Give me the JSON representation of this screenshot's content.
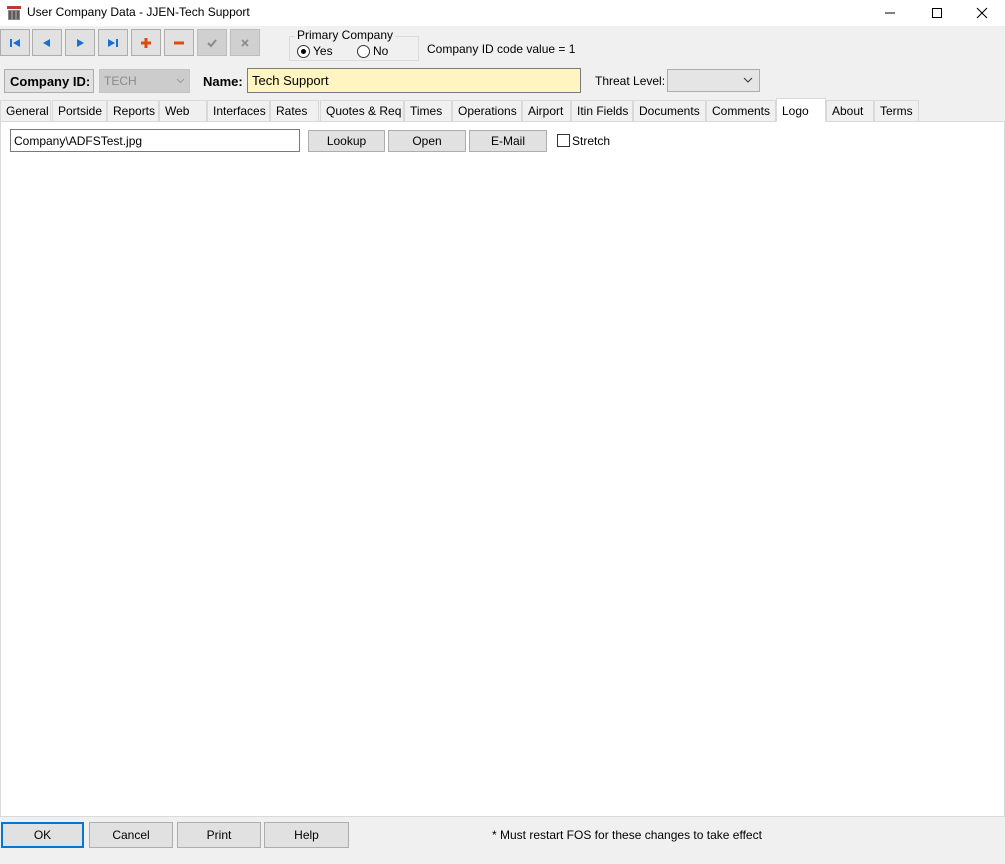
{
  "window": {
    "title": "User Company Data - JJEN-Tech Support",
    "app_icon": "app-icon",
    "controls": [
      "minimize-icon",
      "maximize-icon",
      "close-icon"
    ]
  },
  "toolbar": {
    "buttons": [
      {
        "name": "first-record",
        "icon": "first-icon",
        "enabled": true
      },
      {
        "name": "previous-record",
        "icon": "previous-icon",
        "enabled": true
      },
      {
        "name": "next-record",
        "icon": "next-icon",
        "enabled": true
      },
      {
        "name": "last-record",
        "icon": "last-icon",
        "enabled": true
      },
      {
        "name": "add-record",
        "icon": "plus-icon",
        "enabled": true
      },
      {
        "name": "delete-record",
        "icon": "minus-icon",
        "enabled": true
      },
      {
        "name": "save-record",
        "icon": "check-icon",
        "enabled": false
      },
      {
        "name": "cancel-record",
        "icon": "x-icon",
        "enabled": false
      }
    ]
  },
  "primary_company": {
    "legend": "Primary Company",
    "yes_label": "Yes",
    "no_label": "No",
    "selected": "Yes"
  },
  "company_id_code": "Company ID code value = 1",
  "header": {
    "company_id_label": "Company ID:",
    "company_id_value": "TECH",
    "name_label": "Name:",
    "name_value": "Tech Support",
    "threat_label": "Threat Level:",
    "threat_value": ""
  },
  "tabs": [
    {
      "label": "General"
    },
    {
      "label": "Portside"
    },
    {
      "label": "Reports"
    },
    {
      "label": "Web"
    },
    {
      "label": "Interfaces"
    },
    {
      "label": "Rates"
    },
    {
      "label": "Quotes & Req"
    },
    {
      "label": "Times"
    },
    {
      "label": "Operations"
    },
    {
      "label": "Airport"
    },
    {
      "label": "Itin Fields"
    },
    {
      "label": "Documents"
    },
    {
      "label": "Comments"
    },
    {
      "label": "Logo"
    },
    {
      "label": "About"
    },
    {
      "label": "Terms"
    }
  ],
  "active_tab": "Logo",
  "logo": {
    "path": "Company\\ADFSTest.jpg",
    "lookup_label": "Lookup",
    "open_label": "Open",
    "email_label": "E-Mail",
    "stretch_label": "Stretch",
    "stretch_checked": false
  },
  "footer": {
    "ok_label": "OK",
    "cancel_label": "Cancel",
    "print_label": "Print",
    "help_label": "Help",
    "note": "* Must restart FOS for these changes to take effect"
  },
  "colors": {
    "nav_arrow": "#1a6fd6",
    "add_delete": "#e04a0a",
    "name_field_bg": "#fff5c2",
    "default_button_border": "#0078d7"
  }
}
